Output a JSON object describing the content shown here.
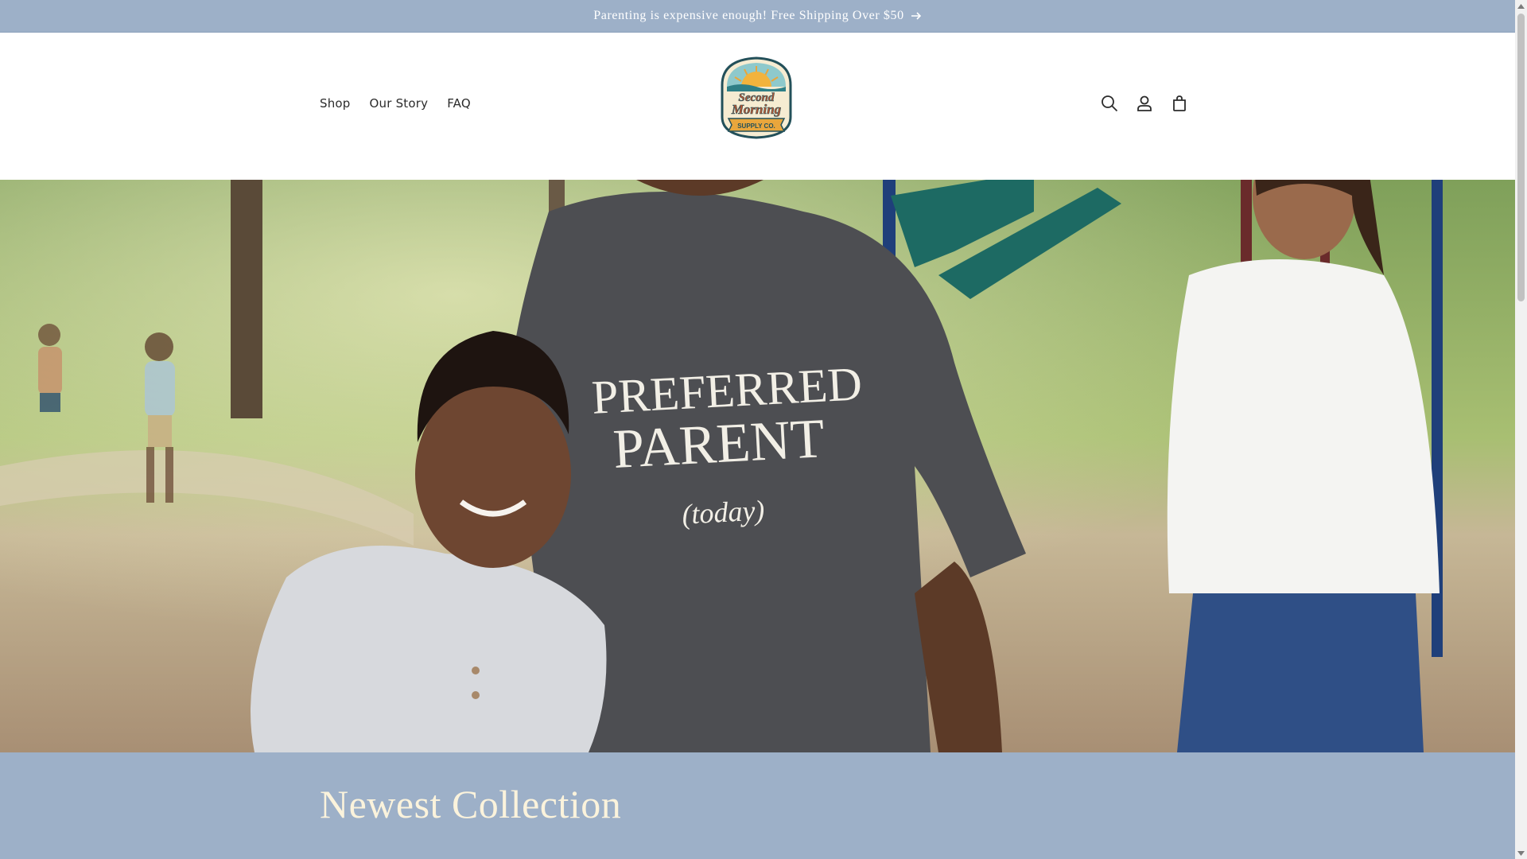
{
  "announcement": {
    "text": "Parenting is expensive enough! Free Shipping Over $50",
    "arrow_icon": "arrow-right-icon"
  },
  "nav": {
    "items": [
      {
        "label": "Shop"
      },
      {
        "label": "Our Story"
      },
      {
        "label": "FAQ"
      }
    ]
  },
  "logo": {
    "line1": "Second",
    "line2": "Morning",
    "banner": "SUPPLY CO."
  },
  "header_icons": [
    "search-icon",
    "account-icon",
    "cart-icon"
  ],
  "hero": {
    "shirt_line1": "PREFERRED",
    "shirt_line2": "PARENT",
    "shirt_line3": "(today)"
  },
  "collection": {
    "title": "Newest Collection"
  },
  "colors": {
    "brand_blue": "#9db0c8",
    "title_cream": "#fbf3dc",
    "text_dark": "#2b2b2b"
  },
  "scrollbar": {
    "position_percent": 0
  }
}
